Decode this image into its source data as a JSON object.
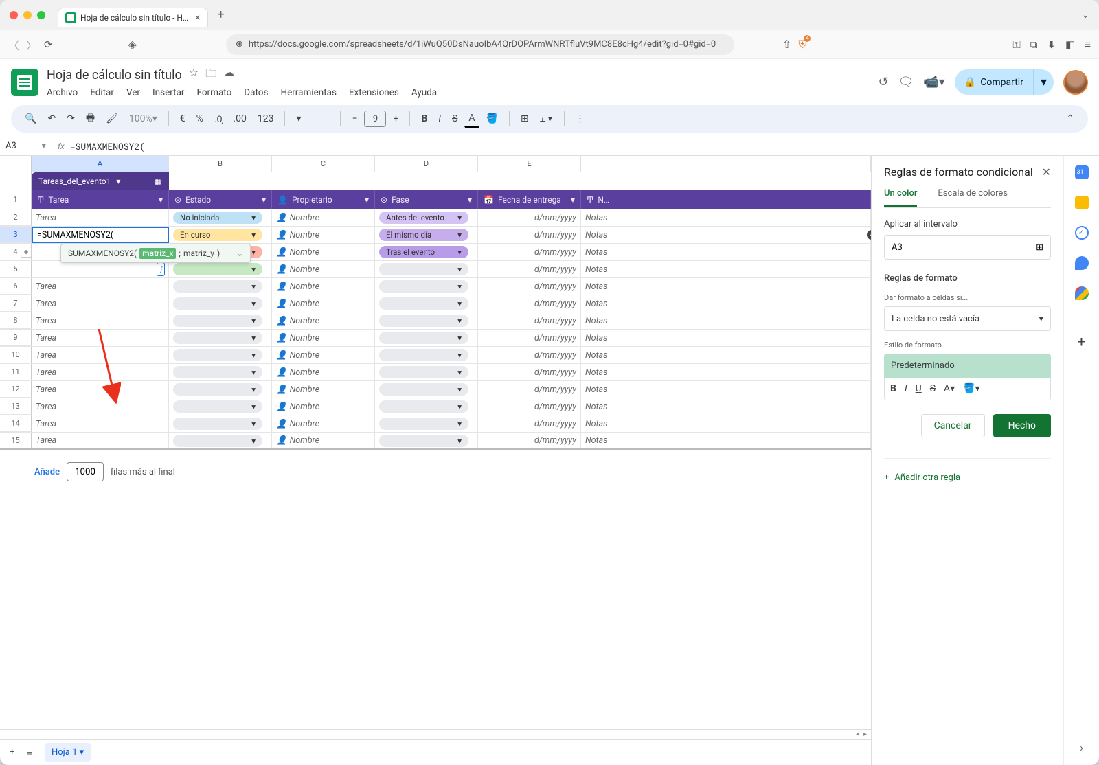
{
  "browser": {
    "tab_title": "Hoja de cálculo sin título - H…",
    "url": "https://docs.google.com/spreadsheets/d/1iWuQ50DsNauoIbA4QrDOPArmWNRTfluVt9MC8E8cHg4/edit?gid=0#gid=0"
  },
  "doc": {
    "title": "Hoja de cálculo sin título",
    "menus": [
      "Archivo",
      "Editar",
      "Ver",
      "Insertar",
      "Formato",
      "Datos",
      "Herramientas",
      "Extensiones",
      "Ayuda"
    ],
    "share": "Compartir"
  },
  "toolbar": {
    "zoom": "100%",
    "font_size": "9"
  },
  "formula": {
    "namebox": "A3",
    "text": "=SUMAXMENOSY2(",
    "cell_text": "=SUMAXMENOSY2(",
    "suggest_fn": "SUMAXMENOSY2(",
    "suggest_arg1": "matriz_x",
    "suggest_sep": ";",
    "suggest_arg2": "matriz_y",
    "suggest_close": ")"
  },
  "columns": [
    "A",
    "B",
    "C",
    "D",
    "E"
  ],
  "table": {
    "chip": "Tareas_del_evento1",
    "headers": {
      "tarea": "Tarea",
      "estado": "Estado",
      "propietario": "Propietario",
      "fase": "Fase",
      "fecha": "Fecha de entrega",
      "notas": "N…"
    }
  },
  "status": {
    "no_iniciada": "No iniciada",
    "en_curso": "En curso"
  },
  "fase": {
    "antes": "Antes del evento",
    "mismo": "El mismo día",
    "tras": "Tras el evento"
  },
  "placeholders": {
    "tarea": "Tarea",
    "nombre": "Nombre",
    "fecha": "d/mm/yyyy",
    "notas": "Notas"
  },
  "row_nums": [
    "1",
    "2",
    "3",
    "4",
    "5",
    "6",
    "7",
    "8",
    "9",
    "10",
    "11",
    "12",
    "13",
    "14",
    "15"
  ],
  "add_rows": {
    "button": "Añade",
    "count": "1000",
    "suffix": "filas más al final"
  },
  "sheet_tab": "Hoja 1",
  "panel": {
    "title": "Reglas de formato condicional",
    "tab1": "Un color",
    "tab2": "Escala de colores",
    "apply_label": "Aplicar al intervalo",
    "range": "A3",
    "rules_label": "Reglas de formato",
    "format_if": "Dar formato a celdas si...",
    "condition": "La celda no está vacía",
    "style_label": "Estilo de formato",
    "style_preview": "Predeterminado",
    "cancel": "Cancelar",
    "done": "Hecho",
    "add_rule": "Añadir otra regla"
  }
}
